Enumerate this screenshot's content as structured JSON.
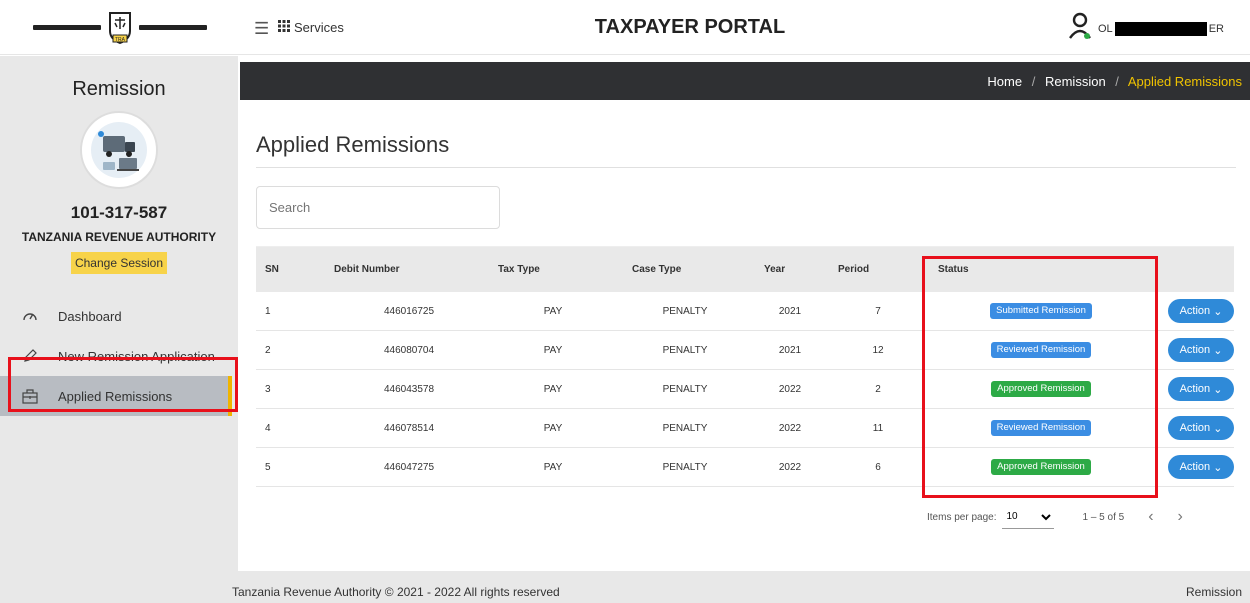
{
  "header": {
    "services_label": "Services",
    "portal_title": "TAXPAYER PORTAL",
    "user_prefix": "OL",
    "user_suffix": "ER",
    "logo_text": "TRA"
  },
  "sidebar": {
    "title": "Remission",
    "tin": "101-317-587",
    "org": "TANZANIA REVENUE AUTHORITY",
    "change_session": "Change Session",
    "items": [
      {
        "label": "Dashboard",
        "icon": "gauge-icon"
      },
      {
        "label": "New Remission Application",
        "icon": "pencil-icon"
      },
      {
        "label": "Applied Remissions",
        "icon": "briefcase-icon",
        "active": true
      }
    ]
  },
  "breadcrumb": {
    "home": "Home",
    "section": "Remission",
    "current": "Applied Remissions"
  },
  "main": {
    "title": "Applied Remissions",
    "search_placeholder": "Search"
  },
  "table": {
    "columns": [
      "SN",
      "Debit Number",
      "Tax Type",
      "Case Type",
      "Year",
      "Period",
      "Status"
    ],
    "action_label": "Action",
    "rows": [
      {
        "sn": "1",
        "debit": "446016725",
        "tax": "PAY",
        "case": "PENALTY",
        "year": "2021",
        "period": "7",
        "status": "Submitted Remission",
        "status_color": "blue"
      },
      {
        "sn": "2",
        "debit": "446080704",
        "tax": "PAY",
        "case": "PENALTY",
        "year": "2021",
        "period": "12",
        "status": "Reviewed Remission",
        "status_color": "blue"
      },
      {
        "sn": "3",
        "debit": "446043578",
        "tax": "PAY",
        "case": "PENALTY",
        "year": "2022",
        "period": "2",
        "status": "Approved Remission",
        "status_color": "green"
      },
      {
        "sn": "4",
        "debit": "446078514",
        "tax": "PAY",
        "case": "PENALTY",
        "year": "2022",
        "period": "11",
        "status": "Reviewed Remission",
        "status_color": "blue"
      },
      {
        "sn": "5",
        "debit": "446047275",
        "tax": "PAY",
        "case": "PENALTY",
        "year": "2022",
        "period": "6",
        "status": "Approved Remission",
        "status_color": "green"
      }
    ]
  },
  "pager": {
    "items_per_page_label": "Items per page:",
    "items_per_page": "10",
    "range": "1 – 5 of 5"
  },
  "footer": {
    "copyright": "Tanzania Revenue Authority © 2021 - 2022 All rights reserved",
    "right": "Remission"
  },
  "colors": {
    "accent_yellow": "#f7d34a",
    "highlight_red": "#e8101b",
    "badge_blue": "#3b8de3",
    "badge_green": "#2daa46",
    "action_blue": "#2f8ad8"
  }
}
